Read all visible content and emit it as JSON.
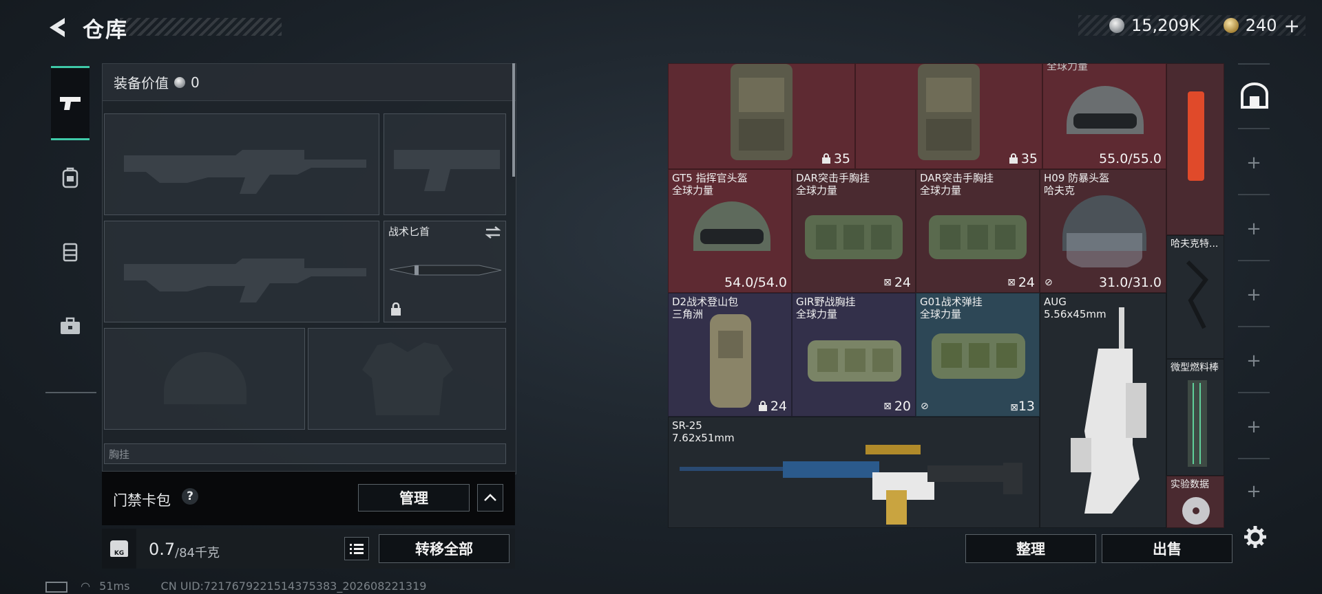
{
  "header": {
    "title": "仓库",
    "currency_silver": "15,209K",
    "currency_gold": "240",
    "add_icon": "plus-icon"
  },
  "rail": {
    "items": [
      "pistol-icon",
      "backpack-icon",
      "vest-icon",
      "toolbox-icon"
    ],
    "active_index": 0
  },
  "equipment": {
    "value_label": "装备价值",
    "value": "0",
    "knife_label": "战术匕首",
    "chest_label": "胸挂",
    "chest_help": "?"
  },
  "access_card": {
    "label": "门禁卡包",
    "help": "?",
    "manage": "管理"
  },
  "weight": {
    "current": "0.7",
    "max": "/84千克",
    "kg_badge": "KG",
    "transfer_all": "转移全部"
  },
  "status": {
    "ping": "51ms",
    "uid": "CN UID:7217679221514375383_202608221319"
  },
  "inventory": {
    "items": [
      {
        "name": "",
        "sub": "",
        "value": "35",
        "icon": "lock-icon"
      },
      {
        "name": "",
        "sub": "",
        "value": "35",
        "icon": "lock-icon"
      },
      {
        "name": "全球力量",
        "sub": "",
        "value": "55.0/55.0",
        "icon": ""
      },
      {
        "name": "GT5 指挥官头盔",
        "sub": "全球力量",
        "value": "54.0/54.0",
        "icon": ""
      },
      {
        "name": "DAR突击手胸挂",
        "sub": "全球力量",
        "value": "24",
        "icon": "vest-icon"
      },
      {
        "name": "DAR突击手胸挂",
        "sub": "全球力量",
        "value": "24",
        "icon": "vest-icon"
      },
      {
        "name": "H09 防暴头盔",
        "sub": "哈夫克",
        "value": "31.0/31.0",
        "icon": "no-slot-icon"
      },
      {
        "name": "哈夫克特...",
        "sub": "",
        "value": "",
        "icon": ""
      },
      {
        "name": "D2战术登山包",
        "sub": "三角洲",
        "value": "24",
        "icon": "lock-icon"
      },
      {
        "name": "GIR野战胸挂",
        "sub": "全球力量",
        "value": "20",
        "icon": "vest-icon"
      },
      {
        "name": "G01战术弹挂",
        "sub": "全球力量",
        "value": "13",
        "icon": "vest-icon"
      },
      {
        "name": "AUG",
        "sub": "5.56x45mm",
        "value": "",
        "icon": ""
      },
      {
        "name": "微型燃料棒",
        "sub": "",
        "value": "",
        "icon": ""
      },
      {
        "name": "SR-25",
        "sub": "7.62x51mm",
        "value": "",
        "icon": ""
      },
      {
        "name": "实验数据",
        "sub": "",
        "value": "",
        "icon": ""
      }
    ]
  },
  "actions": {
    "organize": "整理",
    "sell": "出售"
  },
  "colors": {
    "accent": "#3fc9a8",
    "rarity_red": "#5e2a32",
    "rarity_purple": "#33304a",
    "rarity_teal": "#2d4756"
  }
}
